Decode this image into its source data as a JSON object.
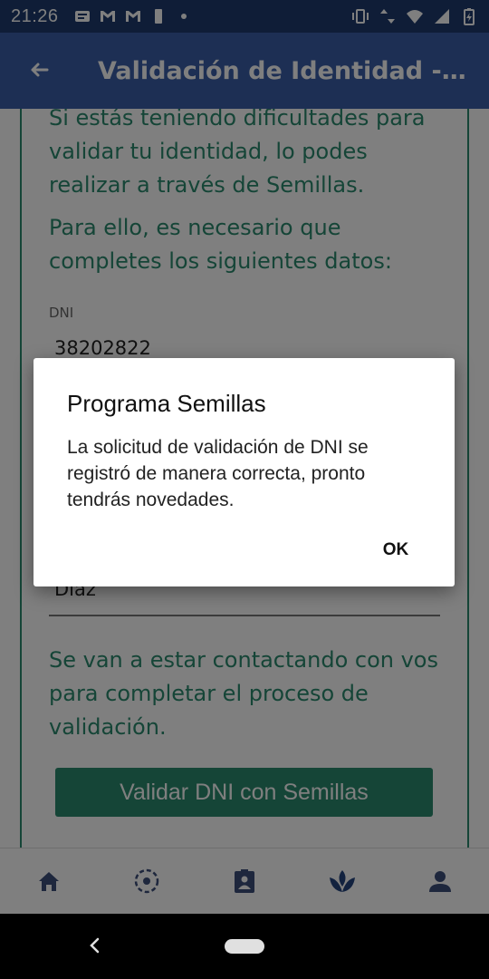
{
  "status_bar": {
    "time": "21:26",
    "left_icons": [
      "message-icon",
      "gmail-icon",
      "gmail-icon",
      "battery-small-icon",
      "dot-icon"
    ],
    "right_icons": [
      "vibrate-icon",
      "data-arrows-icon",
      "wifi-icon",
      "signal-icon",
      "battery-charging-icon"
    ]
  },
  "app_bar": {
    "title": "Validación de Identidad - S...",
    "back_icon": "arrow-back-icon"
  },
  "content": {
    "para1": "Si estás teniendo dificultades para validar tu identidad, lo podes realizar a través de Semillas.",
    "para2": "Para ello, es necesario que completes los siguientes datos:",
    "dni_label": "DNI",
    "dni_value": "38202822",
    "last_name_value": "Diaz",
    "para3": "Se van a estar contactando con vos para completar el proceso de validación.",
    "validate_button": "Validar DNI con Semillas"
  },
  "dialog": {
    "title": "Programa Semillas",
    "message": "La solicitud de validación de DNI se registró de manera correcta, pronto tendrás novedades.",
    "ok_label": "OK"
  },
  "bottom_nav": {
    "items": [
      "home-icon",
      "dashed-circle-icon",
      "id-card-icon",
      "seedling-icon",
      "person-icon"
    ],
    "active_index": 3
  },
  "colors": {
    "status_bar": "#1f3b6e",
    "app_bar": "#3a5ea8",
    "accent_green": "#2a8a6e",
    "nav_icon": "#3d4f7a"
  }
}
